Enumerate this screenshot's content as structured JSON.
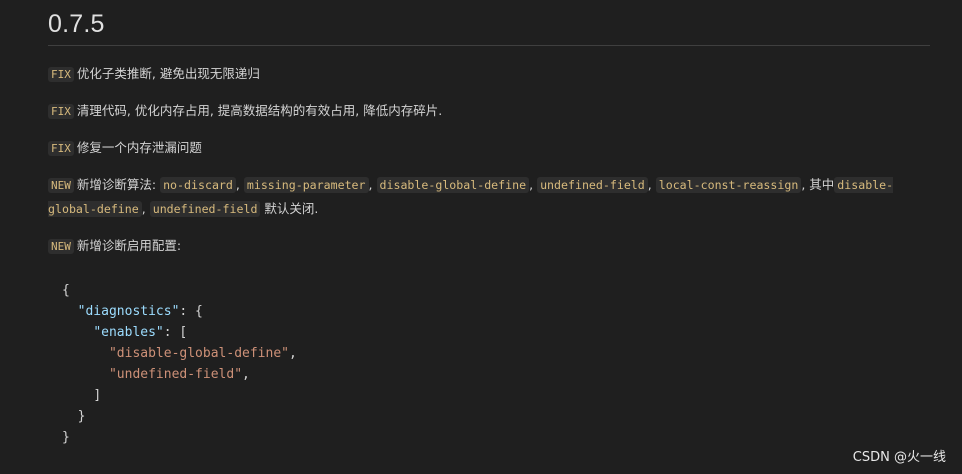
{
  "version": "0.7.5",
  "notes": [
    {
      "tag": "FIX",
      "text": "优化子类推断, 避免出现无限递归"
    },
    {
      "tag": "FIX",
      "text": "清理代码, 优化内存占用, 提高数据结构的有效占用, 降低内存碎片."
    },
    {
      "tag": "FIX",
      "text": "修复一个内存泄漏问题"
    },
    {
      "tag": "NEW",
      "lead": "新增诊断算法:",
      "codes": [
        "no-discard",
        "missing-parameter",
        "disable-global-define",
        "undefined-field",
        "local-const-reassign"
      ],
      "sep": ",",
      "mid": ", 其中",
      "code_a": "disable-global-define",
      "code_b": "undefined-field",
      "tail": "默认关闭."
    },
    {
      "tag": "NEW",
      "text": "新增诊断启用配置:"
    }
  ],
  "code_block": {
    "open_brace": "{",
    "key_diagnostics": "\"diagnostics\"",
    "colon_open_obj": ": {",
    "key_enables": "\"enables\"",
    "colon_open_arr": ": [",
    "item1": "\"disable-global-define\"",
    "item2": "\"undefined-field\"",
    "comma": ",",
    "close_arr": "]",
    "close_obj_inner": "}",
    "close_obj_outer": "}"
  },
  "watermark": "CSDN @火一线"
}
